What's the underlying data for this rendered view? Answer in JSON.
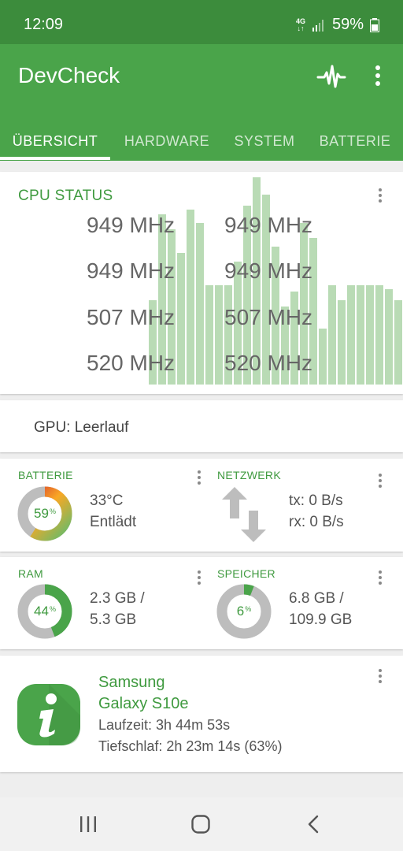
{
  "status_bar": {
    "time": "12:09",
    "network": "4G",
    "battery": "59%"
  },
  "app": {
    "title": "DevCheck",
    "icons": [
      "pulse-icon",
      "more-vert-icon"
    ],
    "tabs": [
      "ÜBERSICHT",
      "HARDWARE",
      "SYSTEM",
      "BATTERIE"
    ],
    "active_tab": 0
  },
  "cpu": {
    "title": "CPU STATUS",
    "frequencies": [
      "949 MHz",
      "949 MHz",
      "949 MHz",
      "949 MHz",
      "507 MHz",
      "507 MHz",
      "520 MHz",
      "520 MHz"
    ],
    "bar_levels": [
      0.39,
      0.79,
      0.72,
      0.61,
      0.81,
      0.75,
      0.46,
      0.46,
      0.46,
      0.57,
      0.83,
      0.96,
      0.88,
      0.64,
      0.36,
      0.43,
      0.75,
      0.68,
      0.26,
      0.46,
      0.39,
      0.46,
      0.46,
      0.46,
      0.46,
      0.44,
      0.39
    ]
  },
  "gpu": {
    "text": "GPU: Leerlauf"
  },
  "battery": {
    "title": "BATTERIE",
    "percent": "59",
    "percent_unit": "%",
    "level": 0.59,
    "temperature": "33°C",
    "state": "Entlädt"
  },
  "network": {
    "title": "NETZWERK",
    "tx": "tx: 0 B/s",
    "rx": "rx: 0 B/s"
  },
  "ram": {
    "title": "RAM",
    "percent": "44",
    "percent_unit": "%",
    "level": 0.44,
    "used": "2.3 GB /",
    "total": "5.3 GB"
  },
  "storage": {
    "title": "SPEICHER",
    "percent": "6",
    "percent_unit": "%",
    "level": 0.06,
    "used": "6.8 GB /",
    "total": "109.9 GB"
  },
  "device": {
    "brand": "Samsung",
    "model": "Galaxy S10e",
    "uptime": "Laufzeit: 3h 44m 53s",
    "deep_sleep": "Tiefschlaf: 2h 23m 14s (63%)"
  },
  "colors": {
    "primary": "#4aa44a",
    "primary_dark": "#3c8c3c",
    "accent_text": "#3f9a3f",
    "bar_fill": "#b9dbb5",
    "donut_track": "#bdbdbd"
  },
  "nav": {
    "icons": [
      "recents-icon",
      "home-icon",
      "back-icon"
    ]
  }
}
